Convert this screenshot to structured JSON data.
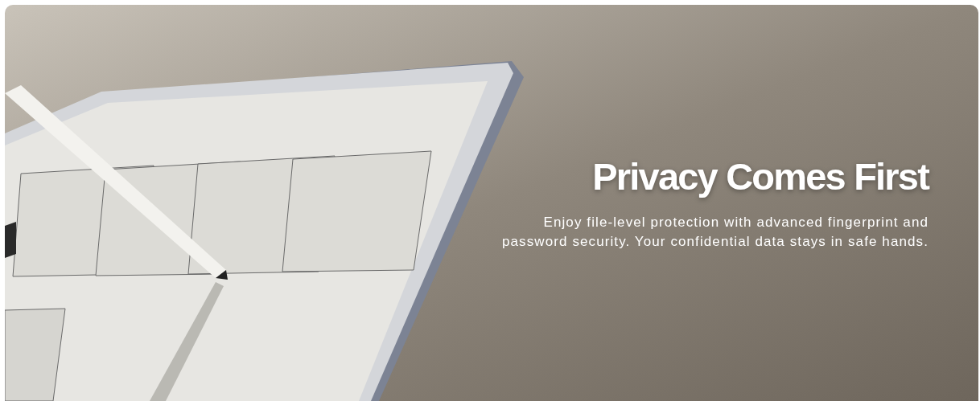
{
  "banner": {
    "heading": "Privacy Comes First",
    "description": "Enjoy file-level protection with advanced fingerprint and password security. Your confidential data stays in safe hands."
  }
}
